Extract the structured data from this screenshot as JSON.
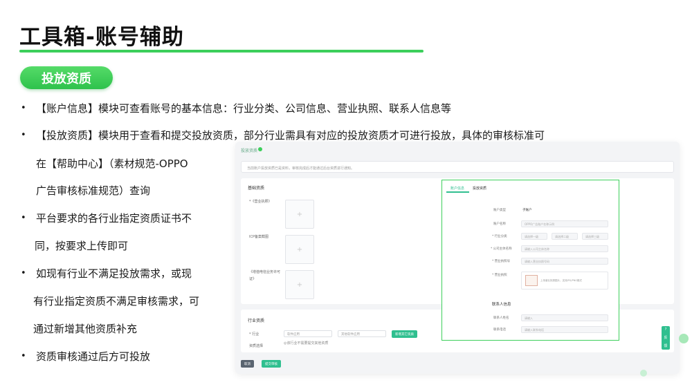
{
  "slide": {
    "title": "工具箱-账号辅助",
    "section": "投放资质"
  },
  "bullets": [
    {
      "text": "【账户信息】模块可查看账号的基本信息：行业分类、公司信息、营业执照、联系人信息等"
    },
    {
      "text": "【投放资质】模块用于查看和提交投放资质，部分行业需具有对应的投放资质才可进行投放，具体的审核标准可",
      "cont": [
        "在【帮助中心】（素材规范-OPPO",
        "广告审核标准规范）查询"
      ]
    },
    {
      "text": "平台要求的各行业指定资质证书不",
      "cont": [
        "同，按要求上传即可"
      ]
    },
    {
      "text": "如现有行业不满足投放需求，或现",
      "cont": [
        "有行业指定资质不满足审核需求，可",
        "通过新增其他资质补充"
      ]
    },
    {
      "text": "资质审核通过后方可投放"
    }
  ],
  "screenshot": {
    "header": "投放资质",
    "notice": "当前账户投放资质已是资料，审核完成后才能通过后台资质进行通知。",
    "basic_card_title": "基础资质",
    "basic_labels": [
      "*《营业执照》",
      "ICP备案截图",
      "《增值电信业务许可",
      "证》"
    ],
    "industry_card_title": "行业资质",
    "industry_label": "* 行业",
    "industry_select_1": "软件应用",
    "industry_select_2": "其他软件应用",
    "add_button": "新增其它资质",
    "qual_label": "资质选择",
    "qual_note": "◎该行业不需要提交其他资质",
    "cancel_button": "取消",
    "submit_button": "提交审核",
    "detail": {
      "tab_account": "账户信息",
      "tab_qual": "投放资质",
      "rows": [
        {
          "label": "账户类型",
          "value": "子账户"
        },
        {
          "label": "账户名称",
          "value": "OPPO广告账户名称示例"
        },
        {
          "label": "* 行业分类",
          "value": "请选择一级"
        },
        {
          "label": "* 公司主体名称",
          "value": "请输入公司主体名称"
        },
        {
          "label": "* 营业执照号",
          "value": "请输入营业执照号码"
        },
        {
          "label": "* 营业执照",
          "value": "上传营业执照图片，支持JPG/PNG格式"
        }
      ],
      "select_2": "请选择二级",
      "select_3": "请选择三级",
      "contact_title": "联系人信息",
      "contact_rows": [
        {
          "label": "联系人姓名",
          "value": "请输入"
        },
        {
          "label": "联系电话",
          "value": "请输入联系电话"
        }
      ]
    },
    "side_tools": [
      "?",
      "反",
      "馈"
    ]
  }
}
